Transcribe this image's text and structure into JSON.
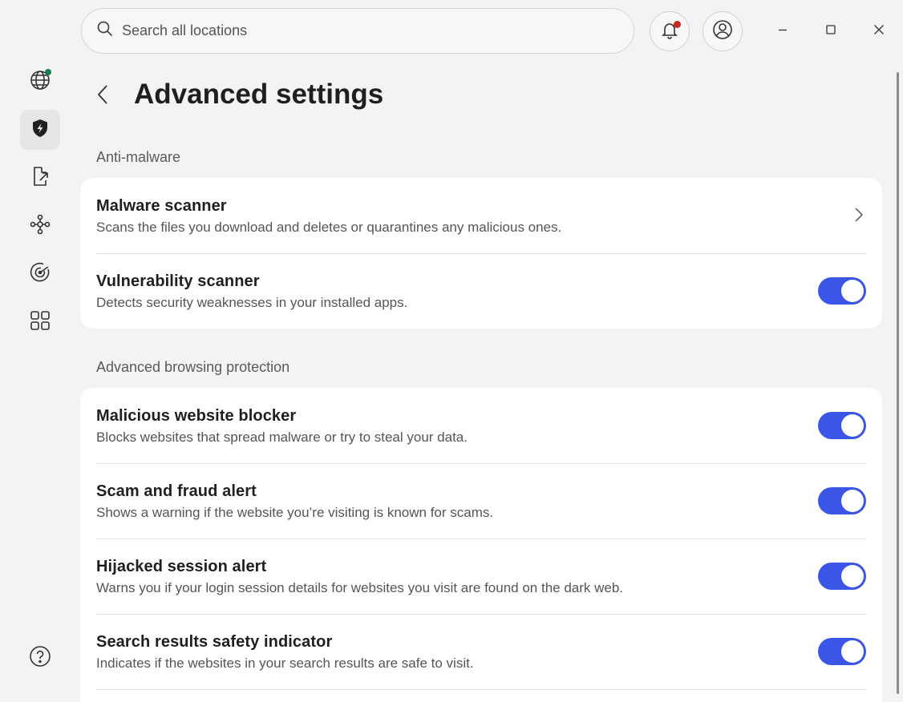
{
  "search": {
    "placeholder": "Search all locations"
  },
  "header": {
    "title": "Advanced settings"
  },
  "sidebar": {
    "items": [
      {
        "name": "globe",
        "status_color": "#1c7f4f"
      },
      {
        "name": "shield-bolt",
        "active": true
      },
      {
        "name": "file-export"
      },
      {
        "name": "network"
      },
      {
        "name": "target"
      },
      {
        "name": "apps-grid"
      },
      {
        "name": "help"
      }
    ]
  },
  "sections": [
    {
      "label": "Anti-malware",
      "rows": [
        {
          "title": "Malware scanner",
          "desc": "Scans the files you download and deletes or quarantines any malicious ones.",
          "control": "chevron"
        },
        {
          "title": "Vulnerability scanner",
          "desc": "Detects security weaknesses in your installed apps.",
          "control": "toggle",
          "on": true
        }
      ]
    },
    {
      "label": "Advanced browsing protection",
      "rows": [
        {
          "title": "Malicious website blocker",
          "desc": "Blocks websites that spread malware or try to steal your data.",
          "control": "toggle",
          "on": true
        },
        {
          "title": "Scam and fraud alert",
          "desc": "Shows a warning if the website you’re visiting is known for scams.",
          "control": "toggle",
          "on": true
        },
        {
          "title": "Hijacked session alert",
          "desc": "Warns you if your login session details for websites you visit are found on the dark web.",
          "control": "toggle",
          "on": true
        },
        {
          "title": "Search results safety indicator",
          "desc": "Indicates if the websites in your search results are safe to visit.",
          "control": "toggle",
          "on": true
        }
      ]
    }
  ],
  "colors": {
    "accent": "#3b55e6",
    "notification": "#c42b1c",
    "status_online": "#1c7f4f"
  }
}
